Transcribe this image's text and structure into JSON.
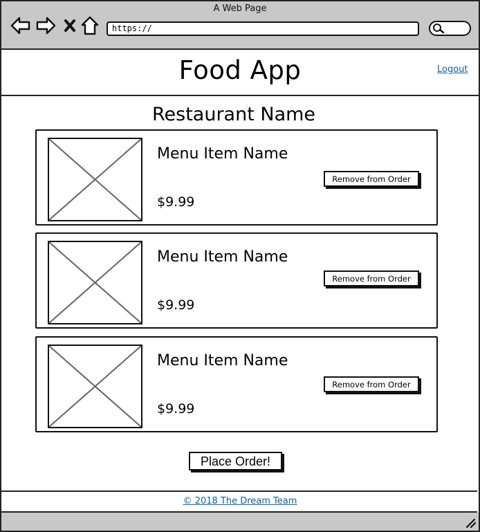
{
  "window": {
    "title": "A Web Page",
    "url": "https://",
    "icons": [
      "back-arrow-icon",
      "forward-arrow-icon",
      "close-icon",
      "home-icon",
      "search-icon",
      "resize-grip-icon"
    ]
  },
  "header": {
    "app_title": "Food App",
    "logout_label": "Logout"
  },
  "restaurant": {
    "name": "Restaurant Name"
  },
  "order_items": [
    {
      "name": "Menu Item Name",
      "price": "$9.99",
      "remove_label": "Remove from Order"
    },
    {
      "name": "Menu Item Name",
      "price": "$9.99",
      "remove_label": "Remove from Order"
    },
    {
      "name": "Menu Item Name",
      "price": "$9.99",
      "remove_label": "Remove from Order"
    }
  ],
  "actions": {
    "place_order_label": "Place Order!"
  },
  "footer": {
    "copyright_label": "© 2018 The Dream Team"
  },
  "colors": {
    "chrome": "#c8c8c8",
    "link": "#0b5fa8",
    "stroke": "#111111"
  }
}
